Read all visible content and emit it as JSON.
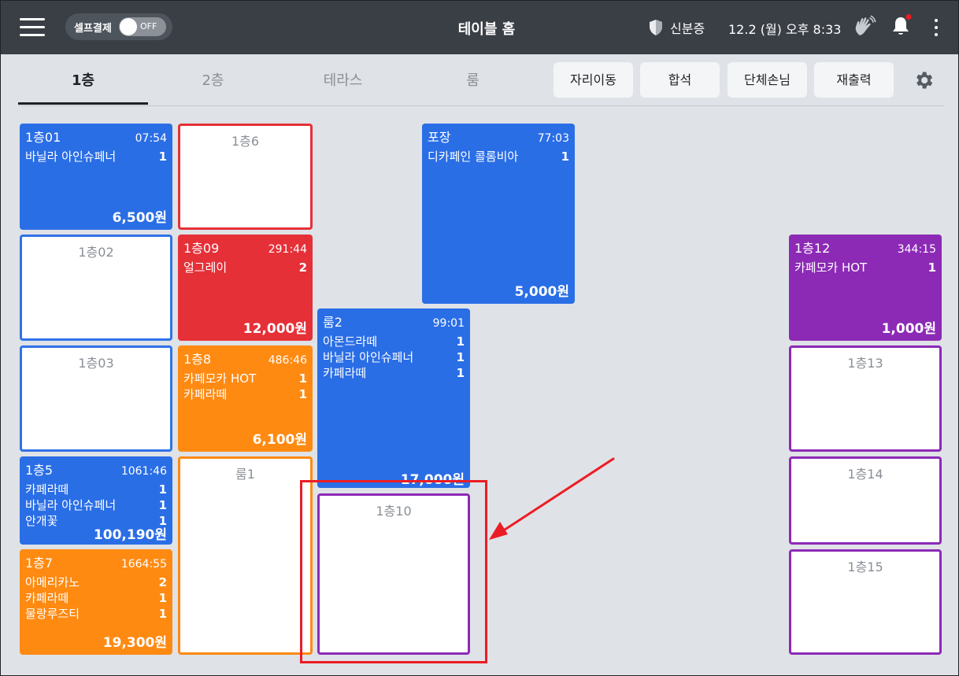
{
  "header": {
    "self_pay_label": "셀프결제",
    "self_pay_toggle": "OFF",
    "title": "테이블 홈",
    "id_label": "신분증",
    "datetime": "12.2 (월) 오후 8:33"
  },
  "tabs": [
    {
      "label": "1층",
      "active": true
    },
    {
      "label": "2층",
      "active": false
    },
    {
      "label": "테라스",
      "active": false
    },
    {
      "label": "룸",
      "active": false
    }
  ],
  "actions": [
    "자리이동",
    "합석",
    "단체손님",
    "재출력"
  ],
  "tables": {
    "t1f01": {
      "name": "1층01",
      "time": "07:54",
      "items": [
        {
          "n": "바닐라 아인슈페너",
          "q": "1"
        }
      ],
      "total": "6,500원"
    },
    "t1f6": {
      "name": "1층6"
    },
    "t1f02": {
      "name": "1층02"
    },
    "t1f09": {
      "name": "1층09",
      "time": "291:44",
      "items": [
        {
          "n": "얼그레이",
          "q": "2"
        }
      ],
      "total": "12,000원"
    },
    "t1f03": {
      "name": "1층03"
    },
    "t1f8": {
      "name": "1층8",
      "time": "486:46",
      "items": [
        {
          "n": "카페모카 HOT",
          "q": "1"
        },
        {
          "n": "카페라떼",
          "q": "1"
        }
      ],
      "total": "6,100원"
    },
    "t1f5": {
      "name": "1층5",
      "time": "1061:46",
      "items": [
        {
          "n": "카페라떼",
          "q": "1"
        },
        {
          "n": "바닐라 아인슈페너",
          "q": "1"
        },
        {
          "n": "안개꽃",
          "q": "1"
        }
      ],
      "total": "100,190원"
    },
    "troom1": {
      "name": "룸1"
    },
    "t1f7": {
      "name": "1층7",
      "time": "1664:55",
      "items": [
        {
          "n": "아메리카노",
          "q": "2"
        },
        {
          "n": "카페라떼",
          "q": "1"
        },
        {
          "n": "물랑루즈티",
          "q": "1"
        }
      ],
      "total": "19,300원"
    },
    "troom2": {
      "name": "룸2",
      "time": "99:01",
      "items": [
        {
          "n": "아몬드라떼",
          "q": "1"
        },
        {
          "n": "바닐라 아인슈페너",
          "q": "1"
        },
        {
          "n": "카페라떼",
          "q": "1"
        }
      ],
      "total": "17,000원"
    },
    "t1f10": {
      "name": "1층10"
    },
    "ttakeout": {
      "name": "포장",
      "time": "77:03",
      "items": [
        {
          "n": "디카페인 콜롬비아",
          "q": "1"
        }
      ],
      "total": "5,000원"
    },
    "t1f12": {
      "name": "1층12",
      "time": "344:15",
      "items": [
        {
          "n": "카페모카 HOT",
          "q": "1"
        }
      ],
      "total": "1,000원"
    },
    "t1f13": {
      "name": "1층13"
    },
    "t1f14": {
      "name": "1층14"
    },
    "t1f15": {
      "name": "1층15"
    }
  },
  "colors": {
    "blue": "#2a6ee6",
    "red": "#e53038",
    "orange": "#ff8a12",
    "purple": "#8c2ab6",
    "annotation": "#ec1c24"
  },
  "icons": [
    "menu-icon",
    "shield-icon",
    "hand-wave-icon",
    "bell-icon",
    "more-vertical-icon",
    "gear-icon",
    "arrow-icon"
  ]
}
